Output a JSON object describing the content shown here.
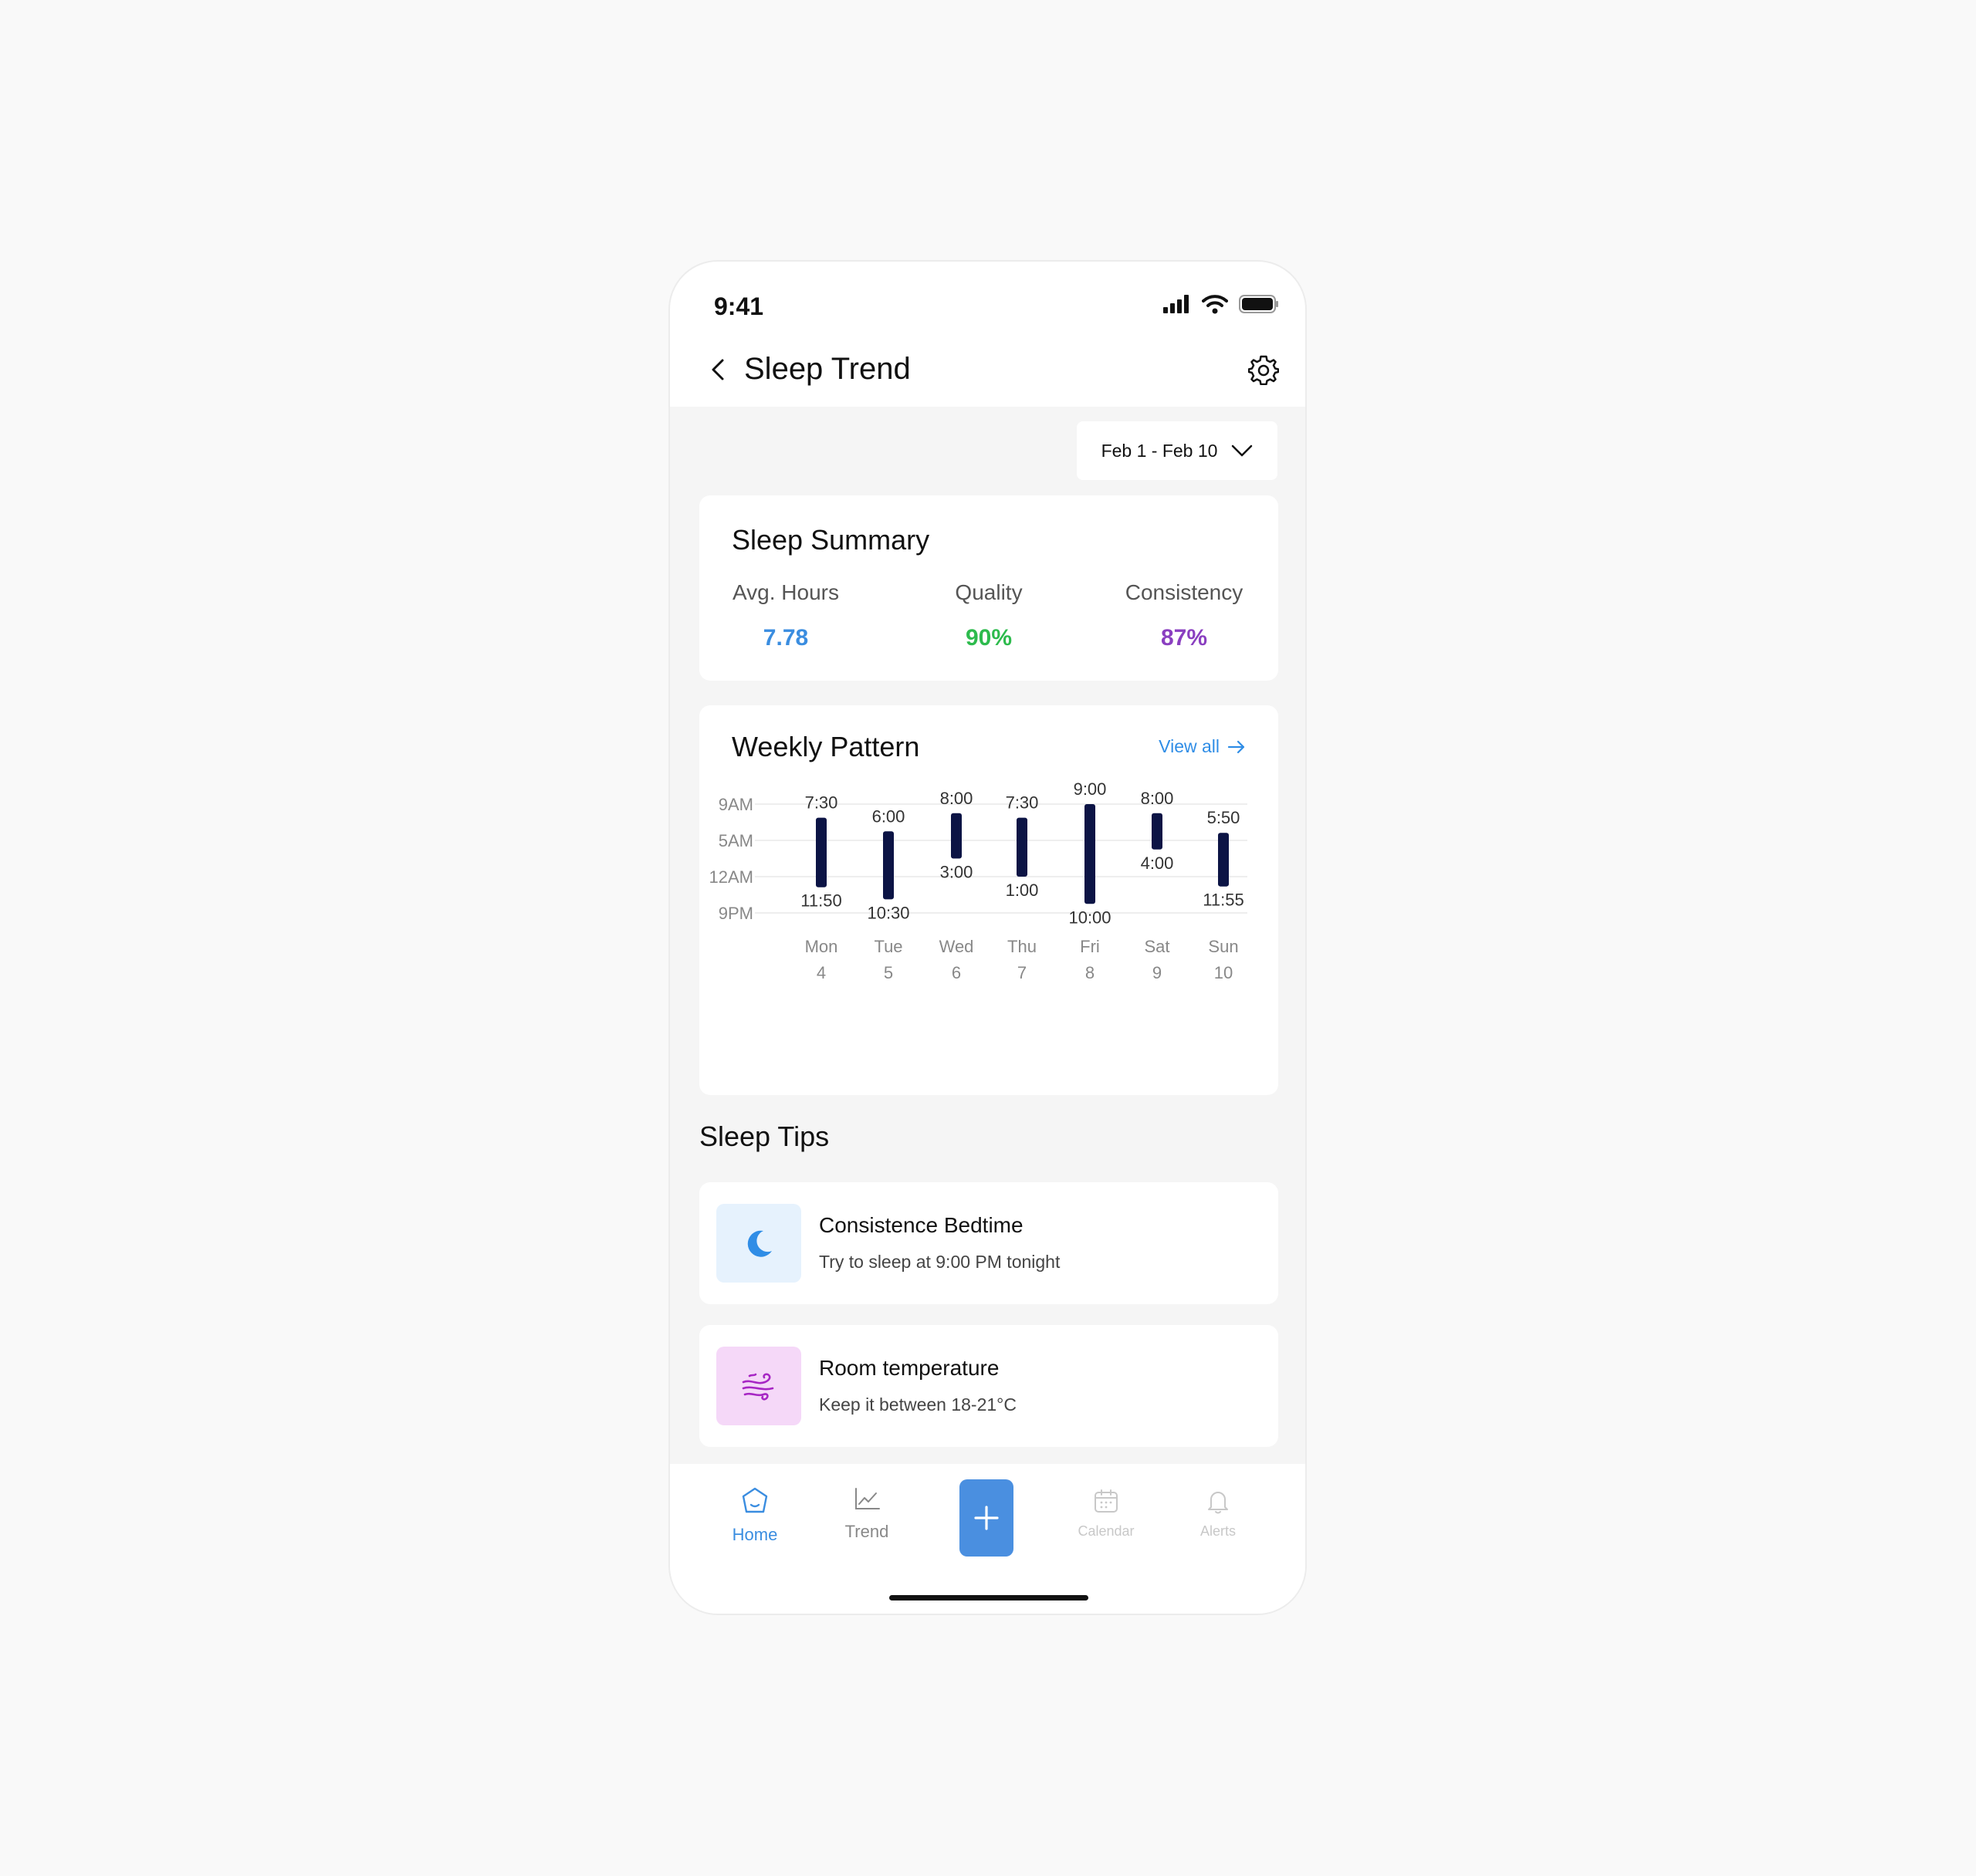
{
  "status_bar": {
    "time": "9:41"
  },
  "header": {
    "title": "Sleep Trend"
  },
  "date_range": {
    "label": "Feb 1 - Feb 10"
  },
  "summary": {
    "title": "Sleep Summary",
    "stats": [
      {
        "label": "Avg. Hours",
        "value": "7.78",
        "color": "#3a8de0"
      },
      {
        "label": "Quality",
        "value": "90%",
        "color": "#2dbb4d"
      },
      {
        "label": "Consistency",
        "value": "87%",
        "color": "#8a3fc0"
      }
    ]
  },
  "weekly": {
    "title": "Weekly Pattern",
    "view_all": "View all"
  },
  "chart_data": {
    "type": "bar",
    "bar_kind": "range",
    "y_tick_labels": [
      "9AM",
      "5AM",
      "12AM",
      "9PM"
    ],
    "categories": [
      {
        "day": "Mon",
        "date": "4"
      },
      {
        "day": "Tue",
        "date": "5"
      },
      {
        "day": "Wed",
        "date": "6"
      },
      {
        "day": "Thu",
        "date": "7"
      },
      {
        "day": "Fri",
        "date": "8"
      },
      {
        "day": "Sat",
        "date": "9"
      },
      {
        "day": "Sun",
        "date": "10"
      }
    ],
    "series": [
      {
        "values": [
          {
            "start": "11:50",
            "end": "7:30",
            "start_hours": -0.17,
            "end_hours": 7.5
          },
          {
            "start": "10:30",
            "end": "6:00",
            "start_hours": -1.5,
            "end_hours": 6.0
          },
          {
            "start": "3:00",
            "end": "8:00",
            "start_hours": 3.0,
            "end_hours": 8.0
          },
          {
            "start": "1:00",
            "end": "7:30",
            "start_hours": 1.0,
            "end_hours": 7.5
          },
          {
            "start": "10:00",
            "end": "9:00",
            "start_hours": -2.0,
            "end_hours": 9.0
          },
          {
            "start": "4:00",
            "end": "8:00",
            "start_hours": 4.0,
            "end_hours": 8.0
          },
          {
            "start": "11:55",
            "end": "5:50",
            "start_hours": -0.08,
            "end_hours": 5.83
          }
        ]
      }
    ],
    "bar_color": "#0c1445"
  },
  "tips": {
    "title": "Sleep Tips",
    "items": [
      {
        "title": "Consistence Bedtime",
        "desc": "Try to sleep at 9:00 PM tonight",
        "icon": "moon-icon",
        "bg": "#e6f2fd",
        "fg": "#2f8de6"
      },
      {
        "title": "Room temperature",
        "desc": "Keep it between 18-21°C",
        "icon": "wind-icon",
        "bg": "#f5d8f8",
        "fg": "#a726c4"
      }
    ]
  },
  "nav": {
    "items": [
      {
        "label": "Home",
        "icon": "home-icon",
        "color": "#3a8de0"
      },
      {
        "label": "Trend",
        "icon": "chart-icon",
        "color": "#888888"
      },
      {
        "label": "Calendar",
        "icon": "calendar-icon",
        "color": "#c8c8c8"
      },
      {
        "label": "Alerts",
        "icon": "bell-icon",
        "color": "#c8c8c8"
      }
    ],
    "add_icon": "plus-icon",
    "add_color": "#4a8fe0"
  }
}
